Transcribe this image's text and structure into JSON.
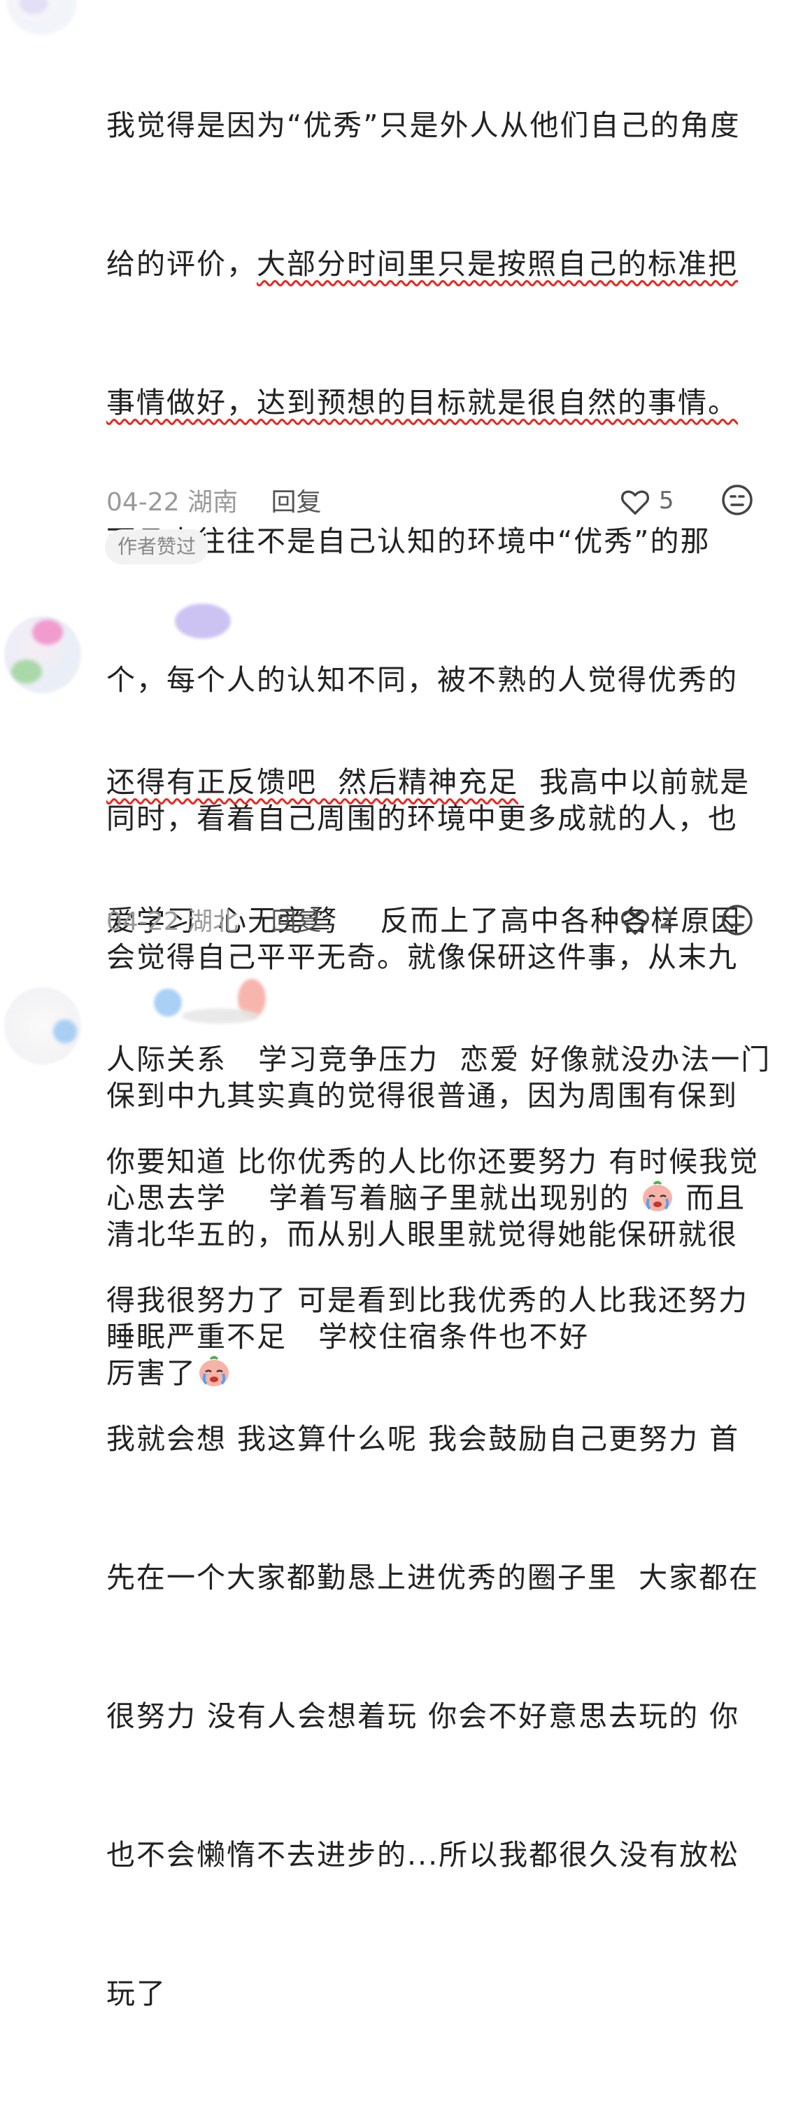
{
  "comments": [
    {
      "lines": [
        "我觉得是因为“优秀”只是外人从他们自己的角度",
        "给的评价，",
        "大部分时间里只是按照自己的标准把",
        "事情做好，达到预想的目标就是很自然的事情。",
        "而且人往往不是自己认知的环境中“优秀”的那",
        "个，每个人的认知不同，被不熟的人觉得优秀的",
        "同时，看着自己周围的环境中更多成就的人，也",
        "会觉得自己平平无奇。就像保研这件事，从末九",
        "保到中九其实真的觉得很普通，因为周围有保到",
        "清北华五的，而从别人眼里就觉得她能保研就很",
        "厉害了"
      ],
      "date": "04-22",
      "location": "湖南",
      "reply_label": "回复",
      "likes": "5",
      "badge": "作者赞过"
    },
    {
      "lines": [
        "还得有正反馈吧  然后精神充足",
        "  我高中以前就是",
        "爱学习  心无旁骛    反而上了高中各种各样原因",
        "人际关系   学习竞争压力  恋爱 好像就没办法一门",
        "心思去学    学着写着脑子里就出现别的 ",
        " 而且",
        "睡眠严重不足   学校住宿条件也不好"
      ],
      "date": "04-22",
      "location": "湖北",
      "reply_label": "回复",
      "likes": "2"
    },
    {
      "lines": [
        "你要知道 比你优秀的人比你还要努力 有时候我觉",
        "得我很努力了 可是看到比我优秀的人比我还努力",
        "我就会想 我这算什么呢 我会鼓励自己更努力 首",
        "先在一个大家都勤恳上进优秀的圈子里  大家都在",
        "很努力 没有人会想着玩 你会不好意思去玩的 你",
        "也不会懒惰不去进步的...所以我都很久没有放松",
        "玩了"
      ]
    }
  ],
  "colors": {
    "underline": "#e8271f",
    "meta_gray": "#9a9a9a",
    "badge_bg": "#f2f2f2"
  },
  "icons": {
    "like": "heart-outline-icon",
    "react": "face-neutral-icon",
    "emoji": "crying-face-emoji"
  }
}
